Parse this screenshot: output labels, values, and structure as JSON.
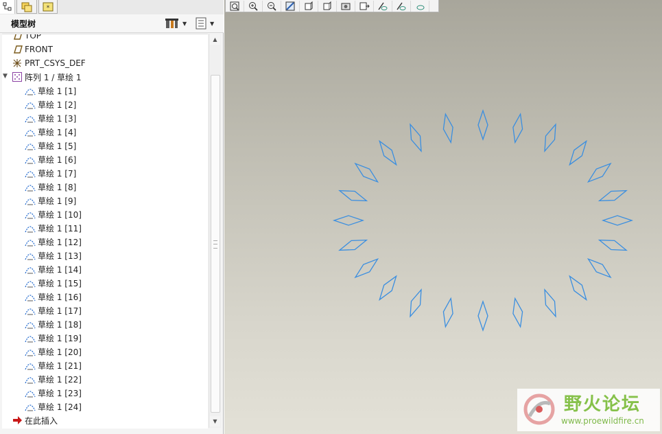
{
  "panel": {
    "title": "模型树",
    "tabs": [
      {
        "icon": "model-tree-icon"
      },
      {
        "icon": "folder-browser-icon"
      },
      {
        "icon": "favorites-icon"
      }
    ],
    "header_buttons": [
      {
        "icon": "tree-settings-icon"
      },
      {
        "icon": "tree-show-icon"
      }
    ]
  },
  "tree": {
    "items": [
      {
        "label": "TOP",
        "icon": "datum-plane-icon",
        "indent": 0
      },
      {
        "label": "FRONT",
        "icon": "datum-plane-icon",
        "indent": 0
      },
      {
        "label": "PRT_CSYS_DEF",
        "icon": "csys-icon",
        "indent": 0
      },
      {
        "label": "阵列 1 / 草绘 1",
        "icon": "pattern-icon",
        "indent": 0,
        "expanded": true
      },
      {
        "label": "草绘 1 [1]",
        "icon": "sketch-icon",
        "indent": 1
      },
      {
        "label": "草绘 1 [2]",
        "icon": "sketch-icon",
        "indent": 1
      },
      {
        "label": "草绘 1 [3]",
        "icon": "sketch-icon",
        "indent": 1
      },
      {
        "label": "草绘 1 [4]",
        "icon": "sketch-icon",
        "indent": 1
      },
      {
        "label": "草绘 1 [5]",
        "icon": "sketch-icon",
        "indent": 1
      },
      {
        "label": "草绘 1 [6]",
        "icon": "sketch-icon",
        "indent": 1
      },
      {
        "label": "草绘 1 [7]",
        "icon": "sketch-icon",
        "indent": 1
      },
      {
        "label": "草绘 1 [8]",
        "icon": "sketch-icon",
        "indent": 1
      },
      {
        "label": "草绘 1 [9]",
        "icon": "sketch-icon",
        "indent": 1
      },
      {
        "label": "草绘 1 [10]",
        "icon": "sketch-icon",
        "indent": 1
      },
      {
        "label": "草绘 1 [11]",
        "icon": "sketch-icon",
        "indent": 1
      },
      {
        "label": "草绘 1 [12]",
        "icon": "sketch-icon",
        "indent": 1
      },
      {
        "label": "草绘 1 [13]",
        "icon": "sketch-icon",
        "indent": 1
      },
      {
        "label": "草绘 1 [14]",
        "icon": "sketch-icon",
        "indent": 1
      },
      {
        "label": "草绘 1 [15]",
        "icon": "sketch-icon",
        "indent": 1
      },
      {
        "label": "草绘 1 [16]",
        "icon": "sketch-icon",
        "indent": 1
      },
      {
        "label": "草绘 1 [17]",
        "icon": "sketch-icon",
        "indent": 1
      },
      {
        "label": "草绘 1 [18]",
        "icon": "sketch-icon",
        "indent": 1
      },
      {
        "label": "草绘 1 [19]",
        "icon": "sketch-icon",
        "indent": 1
      },
      {
        "label": "草绘 1 [20]",
        "icon": "sketch-icon",
        "indent": 1
      },
      {
        "label": "草绘 1 [21]",
        "icon": "sketch-icon",
        "indent": 1
      },
      {
        "label": "草绘 1 [22]",
        "icon": "sketch-icon",
        "indent": 1
      },
      {
        "label": "草绘 1 [23]",
        "icon": "sketch-icon",
        "indent": 1
      },
      {
        "label": "草绘 1 [24]",
        "icon": "sketch-icon",
        "indent": 1
      },
      {
        "label": "在此插入",
        "icon": "insert-here-arrow-icon",
        "indent": 0
      }
    ]
  },
  "toolbar": {
    "buttons": [
      {
        "icon": "refit-icon"
      },
      {
        "icon": "zoom-in-icon"
      },
      {
        "icon": "zoom-out-icon"
      },
      {
        "icon": "repaint-icon"
      },
      {
        "icon": "display-style-icon"
      },
      {
        "icon": "saved-views-icon"
      },
      {
        "icon": "view-manager-icon"
      },
      {
        "icon": "datum-display-icon"
      },
      {
        "icon": "annotation-display-icon"
      },
      {
        "icon": "point-display-icon"
      },
      {
        "icon": "csys-display-icon"
      }
    ]
  },
  "viewport": {
    "pattern_count": 24,
    "sketch_color": "#3a8ee0",
    "background_top": "#a8a69b",
    "background_bottom": "#e3e1d7"
  },
  "watermark": {
    "title": "野火论坛",
    "url": "www.proewildfire.cn"
  },
  "colors": {
    "insert_arrow": "#c81818",
    "pattern_icon": "#8a3fa3",
    "sketch_icon": "#2a6fd0"
  }
}
